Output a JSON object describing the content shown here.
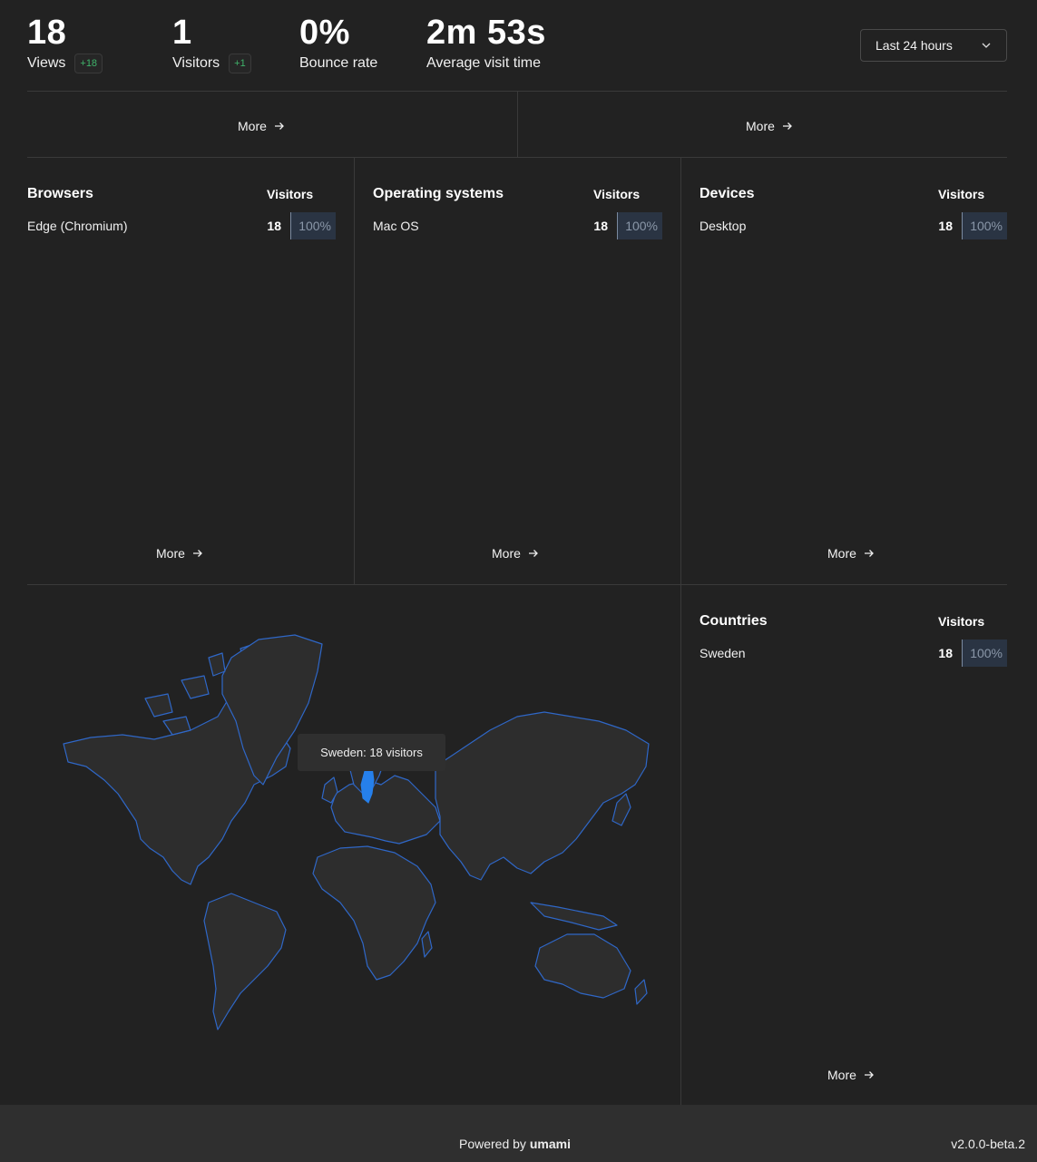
{
  "metrics": [
    {
      "value": "18",
      "label": "Views",
      "change": "+18"
    },
    {
      "value": "1",
      "label": "Visitors",
      "change": "+1"
    },
    {
      "value": "0%",
      "label": "Bounce rate"
    },
    {
      "value": "2m 53s",
      "label": "Average visit time"
    }
  ],
  "date_filter": {
    "selected": "Last 24 hours",
    "icon": "chevron-down-icon"
  },
  "more_label": "More",
  "panels": {
    "browsers": {
      "title": "Browsers",
      "column": "Visitors",
      "rows": [
        {
          "label": "Edge (Chromium)",
          "count": "18",
          "percent": "100%"
        }
      ]
    },
    "os": {
      "title": "Operating systems",
      "column": "Visitors",
      "rows": [
        {
          "label": "Mac OS",
          "count": "18",
          "percent": "100%"
        }
      ]
    },
    "devices": {
      "title": "Devices",
      "column": "Visitors",
      "rows": [
        {
          "label": "Desktop",
          "count": "18",
          "percent": "100%"
        }
      ]
    },
    "countries": {
      "title": "Countries",
      "column": "Visitors",
      "rows": [
        {
          "label": "Sweden",
          "count": "18",
          "percent": "100%"
        }
      ]
    }
  },
  "map": {
    "tooltip": "Sweden: 18 visitors",
    "highlight_color": "#2680eb",
    "border_color": "#2f67c7",
    "land_color": "#2d2d2d"
  },
  "footer": {
    "powered_prefix": "Powered by",
    "brand": "umami",
    "version": "v2.0.0-beta.2"
  }
}
